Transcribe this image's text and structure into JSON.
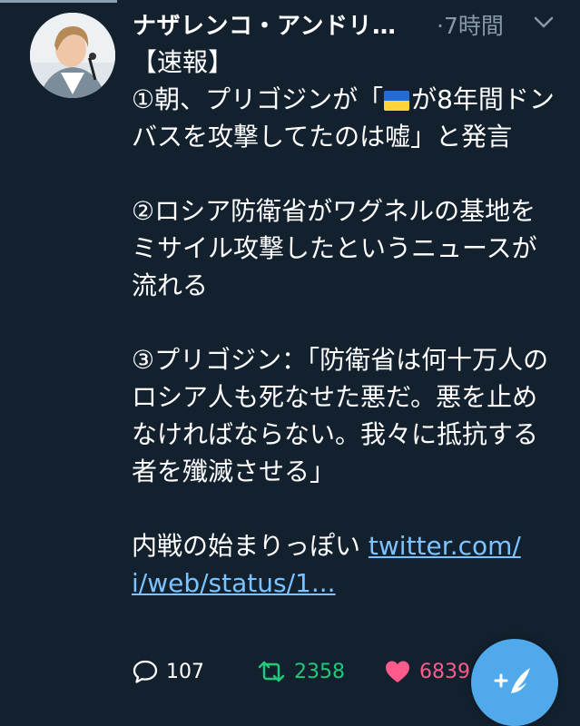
{
  "author": {
    "display_name": "ナザレンコ・アンドリ…"
  },
  "meta": {
    "time": "·7時間"
  },
  "tweet": {
    "line_before_flag": "【速報】\n①朝、プリゴジンが「",
    "line_after_flag": "が8年間ドンバスを攻撃してたのは嘘」と発言\n\n②ロシア防衛省がワグネルの基地をミサイル攻撃したというニュースが流れる\n\n③プリゴジン：「防衛省は何十万人のロシア人も死なせた悪だ。悪を止めなければならない。我々に抵抗する者を殲滅させる」\n\n内戦の始まりっぽい ",
    "link_text": "twitter.com/\ni/web/status/1..."
  },
  "actions": {
    "reply_count": "107",
    "retweet_count": "2358",
    "like_count": "6839"
  },
  "icons": {
    "caret": "chevron-down-icon",
    "reply": "reply-icon",
    "retweet": "retweet-icon",
    "like": "heart-icon",
    "compose": "compose-icon"
  },
  "colors": {
    "background": "#13212f",
    "link": "#7cc3ff",
    "retweet": "#20c97a",
    "like": "#ff5a8c",
    "fab": "#4fa9ea"
  }
}
